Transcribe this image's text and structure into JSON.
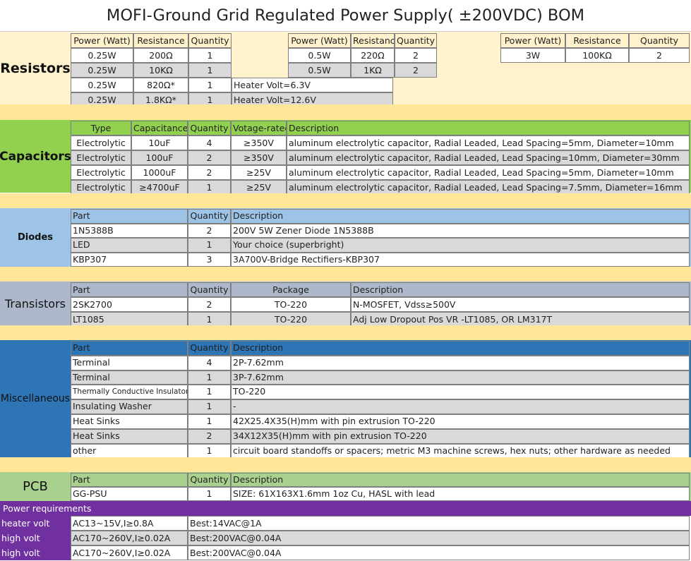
{
  "title": "MOFI-Ground Grid Regulated Power Supply( ±200VDC) BOM",
  "colors": {
    "resistor_bg": "#fff2cc",
    "spacer": "#ffe699",
    "capacitor_head": "#92d050",
    "capacitor_label": "#92d050",
    "diode_head": "#9dc3e6",
    "transistor_head": "#adb9ca",
    "misc_head": "#2e75b6",
    "pcb_head": "#a9d18e",
    "power_purple": "#7030a0",
    "row_grey": "#d9d9d9",
    "row_white": "#ffffff"
  },
  "resistors": {
    "label": "Resistors",
    "tableA": {
      "headers": [
        "Power (Watt)",
        "Resistance",
        "Quantity"
      ],
      "rows": [
        [
          "0.25W",
          "200Ω",
          "1",
          ""
        ],
        [
          "0.25W",
          "10KΩ",
          "1",
          ""
        ],
        [
          "0.25W",
          "820Ω*",
          "1",
          "Heater Volt=6.3V"
        ],
        [
          "0.25W",
          "1.8KΩ*",
          "1",
          "Heater Volt=12.6V"
        ]
      ]
    },
    "tableB": {
      "headers": [
        "Power (Watt)",
        "Resistance",
        "Quantity"
      ],
      "rows": [
        [
          "0.5W",
          "220Ω",
          "2"
        ],
        [
          "0.5W",
          "1KΩ",
          "2"
        ]
      ]
    },
    "tableC": {
      "headers": [
        "Power (Watt)",
        "Resistance",
        "Quantity"
      ],
      "rows": [
        [
          "3W",
          "100KΩ",
          "2"
        ]
      ]
    }
  },
  "capacitors": {
    "label": "Capacitors",
    "headers": [
      "Type",
      "Capacitance",
      "Quantity",
      "Votage-rated",
      "Description"
    ],
    "rows": [
      [
        "Electrolytic",
        "10uF",
        "4",
        "≥350V",
        "aluminum electrolytic capacitor,  Radial Leaded,  Lead Spacing=5mm,  Diameter=10mm"
      ],
      [
        "Electrolytic",
        "100uF",
        "2",
        "≥350V",
        "aluminum electrolytic capacitor,  Radial Leaded,  Lead Spacing=10mm,  Diameter=30mm"
      ],
      [
        "Electrolytic",
        "1000uF",
        "2",
        "≥25V",
        "aluminum electrolytic capacitor,  Radial Leaded,  Lead Spacing=5mm,  Diameter=10mm"
      ],
      [
        "Electrolytic",
        "≥4700uF",
        "1",
        "≥25V",
        "aluminum electrolytic capacitor,  Radial Leaded,  Lead Spacing=7.5mm,  Diameter=16mm"
      ]
    ]
  },
  "diodes": {
    "label": "Diodes",
    "headers": [
      "Part",
      "Quantity",
      "Description"
    ],
    "rows": [
      [
        "1N5388B",
        "2",
        "200V 5W Zener Diode 1N5388B"
      ],
      [
        "LED",
        "1",
        "Your choice (superbright)"
      ],
      [
        "KBP307",
        "3",
        "3A700V-Bridge Rectifiers-KBP307"
      ]
    ]
  },
  "transistors": {
    "label": "Transistors",
    "headers": [
      "Part",
      "Quantity",
      "Package",
      "Description"
    ],
    "rows": [
      [
        "2SK2700",
        "2",
        "TO-220",
        "N-MOSFET, Vdss≥500V"
      ],
      [
        "LT1085",
        "1",
        "TO-220",
        " Adj Low Dropout Pos VR -LT1085,  OR LM317T"
      ]
    ]
  },
  "misc": {
    "label": "Miscellaneous",
    "headers": [
      "Part",
      "Quantity",
      "Description"
    ],
    "rows": [
      [
        "Terminal",
        "4",
        "2P-7.62mm"
      ],
      [
        "Terminal",
        "1",
        "3P-7.62mm"
      ],
      [
        "Thermally Conductive Insulator",
        "1",
        "TO-220"
      ],
      [
        "Insulating Washer",
        "1",
        " -"
      ],
      [
        "Heat Sinks",
        "1",
        "42X25.4X35(H)mm with pin extrusion TO-220"
      ],
      [
        "Heat Sinks",
        "2",
        "34X12X35(H)mm with pin extrusion TO-220"
      ],
      [
        "other",
        "1",
        "circuit board standoffs or spacers;  metric M3 machine screws, hex nuts;  other hardware as needed"
      ]
    ]
  },
  "pcb": {
    "label": "PCB",
    "headers": [
      "Part",
      "Quantity",
      "Description"
    ],
    "rows": [
      [
        "GG-PSU",
        "1",
        "SIZE:  61X163X1.6mm    1oz Cu, HASL with lead"
      ]
    ]
  },
  "power": {
    "header": "Power requirements",
    "rows": [
      [
        "heater volt",
        "AC13~15V,I≥0.8A",
        "Best:14VAC@1A"
      ],
      [
        "high volt",
        "AC170~260V,I≥0.02A",
        "Best:200VAC@0.04A"
      ],
      [
        "high volt",
        "AC170~260V,I≥0.02A",
        "Best:200VAC@0.04A"
      ]
    ]
  }
}
